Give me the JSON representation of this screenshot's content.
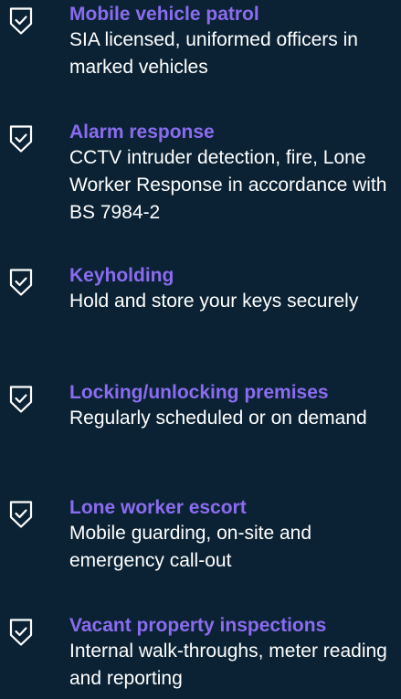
{
  "colors": {
    "background": "#0a2233",
    "title": "#8b6cf0",
    "text": "#ffffff",
    "icon": "#ffffff"
  },
  "icon_name": "shield-check-icon",
  "features": [
    {
      "title": "Mobile vehicle patrol",
      "description": "SIA licensed, uniformed officers in marked vehicles"
    },
    {
      "title": "Alarm response",
      "description": "CCTV intruder detection, fire, Lone Worker Response in accordance with BS 7984-2"
    },
    {
      "title": "Keyholding",
      "description": "Hold and store your keys securely"
    },
    {
      "title": "Locking/unlocking premises",
      "description": "Regularly scheduled or on demand"
    },
    {
      "title": "Lone worker escort",
      "description": "Mobile guarding, on-site and emergency call-out"
    },
    {
      "title": "Vacant property inspections",
      "description": "Internal walk-throughs, meter reading and reporting"
    }
  ]
}
